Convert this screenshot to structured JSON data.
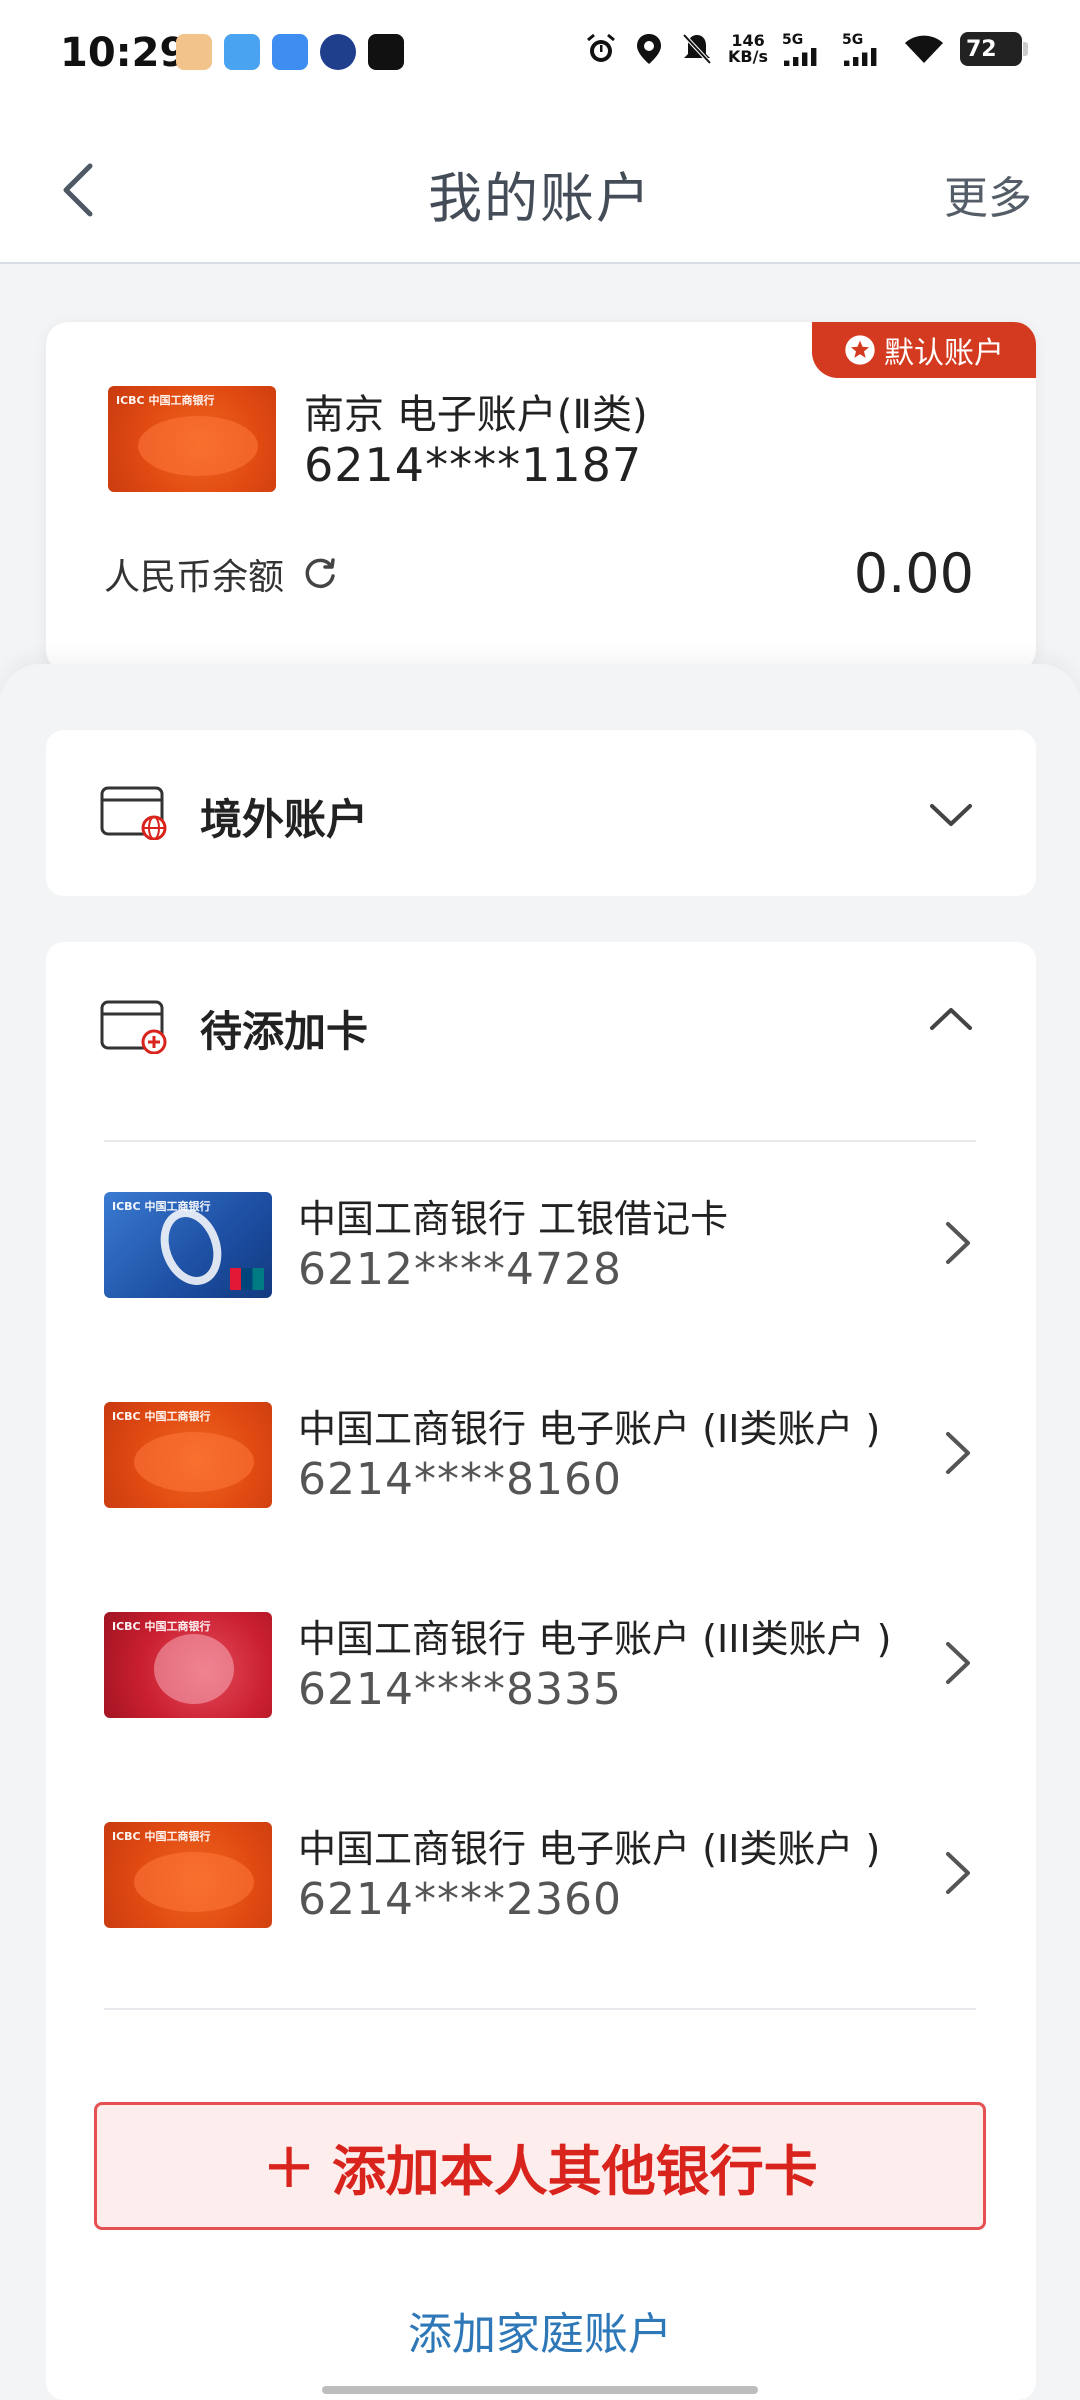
{
  "status_bar": {
    "time": "10:29",
    "net_speed_value": "146",
    "net_speed_unit": "KB/s",
    "signal_1": "5G",
    "signal_2": "5G",
    "battery": "72"
  },
  "header": {
    "title": "我的账户",
    "more_label": "更多"
  },
  "default_account": {
    "badge": "默认账户",
    "name": "南京 电子账户(Ⅱ类)",
    "number": "6214****1187",
    "balance_label": "人民币余额",
    "balance": "0.00"
  },
  "overseas_section": {
    "title": "境外账户"
  },
  "pending_section": {
    "title": "待添加卡",
    "cards": [
      {
        "title": "中国工商银行 工银借记卡",
        "number": "6212****4728",
        "style": "blue"
      },
      {
        "title": "中国工商银行 电子账户 (II类账户 )",
        "number": "6214****8160",
        "style": "orange"
      },
      {
        "title": "中国工商银行 电子账户 (III类账户 )",
        "number": "6214****8335",
        "style": "red"
      },
      {
        "title": "中国工商银行 电子账户 (II类账户 )",
        "number": "6214****2360",
        "style": "orange"
      }
    ]
  },
  "actions": {
    "add_card_label": "添加本人其他银行卡",
    "add_family_label": "添加家庭账户"
  },
  "colors": {
    "accent_red": "#d9241d",
    "link_blue": "#2f78b8",
    "badge_red": "#d43a1f"
  }
}
